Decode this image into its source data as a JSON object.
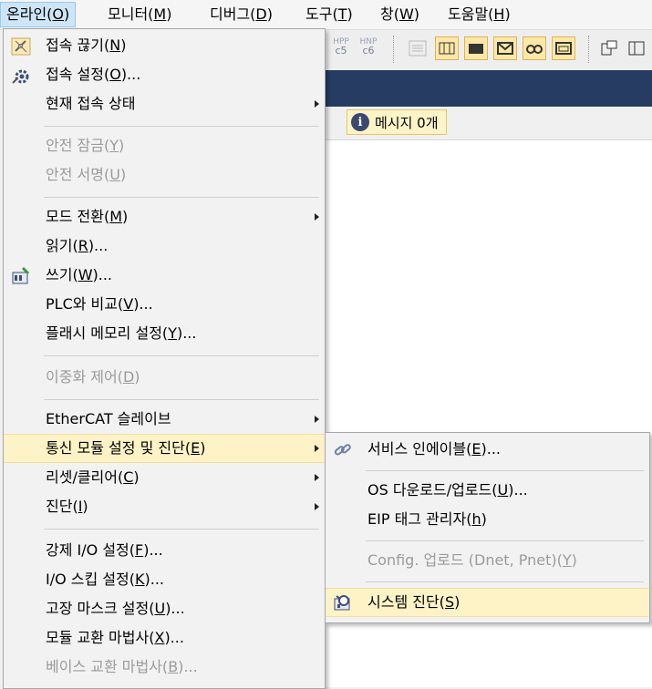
{
  "menubar": {
    "items": [
      {
        "text": "온라인(",
        "key": "O",
        "end": ")"
      },
      {
        "text": "모니터(",
        "key": "M",
        "end": ")"
      },
      {
        "text": "디버그(",
        "key": "D",
        "end": ")"
      },
      {
        "text": "도구(",
        "key": "T",
        "end": ")"
      },
      {
        "text": "창(",
        "key": "W",
        "end": ")"
      },
      {
        "text": "도움말(",
        "key": "H",
        "end": ")"
      }
    ]
  },
  "toolbar": {
    "c5": "c5",
    "c6": "c6",
    "c5_top": "HPP",
    "c6_top": "HNP"
  },
  "message_bar": {
    "info_glyph": "i",
    "text": "메시지 0개"
  },
  "online_menu": {
    "items": [
      {
        "text": "접속 끊기(",
        "key": "N",
        "end": ")",
        "icon": "disconnect-icon"
      },
      {
        "text": "접속 설정(",
        "key": "O",
        "end": ")...",
        "icon": "connection-settings-icon"
      },
      {
        "text": "현재 접속 상태",
        "key": "",
        "end": ""
      },
      {
        "text": "안전 잠금(",
        "key": "Y",
        "end": ")"
      },
      {
        "text": "안전 서명(",
        "key": "U",
        "end": ")"
      },
      {
        "text": "모드 전환(",
        "key": "M",
        "end": ")"
      },
      {
        "text": "읽기(",
        "key": "R",
        "end": ")..."
      },
      {
        "text": "쓰기(",
        "key": "W",
        "end": ")...",
        "icon": "write-icon"
      },
      {
        "text": "PLC와 비교(",
        "key": "V",
        "end": ")..."
      },
      {
        "text": "플래시 메모리 설정(",
        "key": "Y",
        "end": ")..."
      },
      {
        "text": "이중화 제어(",
        "key": "D",
        "end": ")"
      },
      {
        "text": "EtherCAT 슬레이브",
        "key": "",
        "end": ""
      },
      {
        "text": "통신 모듈 설정 및 진단(",
        "key": "E",
        "end": ")"
      },
      {
        "text": "리셋/클리어(",
        "key": "C",
        "end": ")"
      },
      {
        "text": "진단(",
        "key": "I",
        "end": ")"
      },
      {
        "text": "강제 I/O 설정(",
        "key": "F",
        "end": ")..."
      },
      {
        "text": "I/O 스킵 설정(",
        "key": "K",
        "end": ")..."
      },
      {
        "text": "고장 마스크 설정(",
        "key": "U",
        "end": ")..."
      },
      {
        "text": "모듈 교환 마법사(",
        "key": "X",
        "end": ")..."
      },
      {
        "text": "베이스 교환 마법사(",
        "key": "B",
        "end": ")..."
      }
    ]
  },
  "comm_submenu": {
    "items": [
      {
        "text": "서비스 인에이블(",
        "key": "E",
        "end": ")...",
        "icon": "link-icon"
      },
      {
        "text": "OS 다운로드/업로드(",
        "key": "U",
        "end": ")..."
      },
      {
        "text": "EIP 태그 관리자(",
        "key": "h",
        "end": ")"
      },
      {
        "text": "Config. 업로드 (Dnet, Pnet)(",
        "key": "Y",
        "end": ")"
      },
      {
        "text": "시스템 진단(",
        "key": "S",
        "end": ")",
        "icon": "system-diagnosis-icon"
      }
    ]
  }
}
